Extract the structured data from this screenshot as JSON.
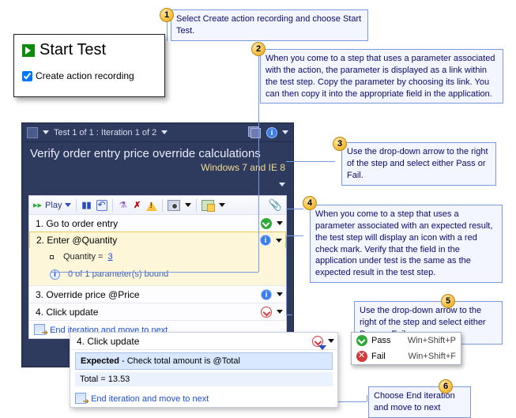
{
  "callouts": {
    "c1": "Select Create action recording and choose Start Test.",
    "c2": "When you come to a step that uses a parameter associated with the action, the parameter is displayed as a link within the test step. Copy the parameter by choosing its link. You can then copy it into the appropriate field in the application.",
    "c3": "Use the drop-down arrow to the right of the step and select either Pass or Fail.",
    "c4": "When you come to a step that uses a parameter associated with an expected result, the test step will display an icon with a red check mark. Verify that the field in the application under test is the same as the expected result in the test step.",
    "c5": "Use the drop-down arrow to the right of the step and select either Pass or Fail.",
    "c6": "Choose End iteration and move to next"
  },
  "start_card": {
    "title": "Start Test",
    "checkbox_label": "Create action recording",
    "checkbox_checked": true
  },
  "runner": {
    "counter": "Test 1 of 1 : Iteration 1 of 2",
    "title": "Verify order entry price override calculations",
    "subtitle": "Windows 7 and IE 8",
    "toolbar": {
      "play": "Play"
    },
    "steps": [
      {
        "n": "1.",
        "text": "Go to order entry",
        "status": "ok"
      },
      {
        "n": "2.",
        "text": "Enter @Quantity",
        "status": "info",
        "active": true,
        "sub_qty_label": "Quantity = ",
        "sub_qty_value": "3",
        "sub_info": "0 of 1 parameter(s) bound"
      },
      {
        "n": "3.",
        "text": "Override price @Price",
        "status": "info"
      },
      {
        "n": "4.",
        "text": "Click update",
        "status": "redcheck"
      }
    ],
    "end_link": "End iteration and move to next"
  },
  "detail": {
    "step_n": "4.",
    "step_text": "Click update",
    "expected_label": "Expected",
    "expected_text": " - Check total amount is @Total",
    "total_text": "Total = 13.53",
    "end_link": "End iteration and move to next"
  },
  "passfail": {
    "pass": "Pass",
    "pass_hot": "Win+Shift+P",
    "fail": "Fail",
    "fail_hot": "Win+Shift+F"
  }
}
